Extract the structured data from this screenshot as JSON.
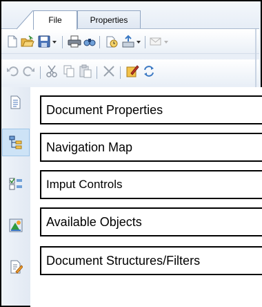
{
  "tabs": [
    {
      "label": "File",
      "active": true
    },
    {
      "label": "Properties",
      "active": false
    }
  ],
  "toolbar_row1": [
    "new-document-icon",
    "open-folder-icon",
    "save-icon",
    "dropdown-icon",
    "print-icon",
    "find-icon",
    "history-icon",
    "export-icon",
    "dropdown-icon",
    "send-mail-icon",
    "dropdown-icon"
  ],
  "toolbar_row2": [
    "undo-icon",
    "redo-icon",
    "cut-icon",
    "copy-icon",
    "paste-icon",
    "delete-icon",
    "edit-icon",
    "refresh-icon"
  ],
  "side_panels": [
    {
      "label": "Document Properties",
      "icon": "document-properties-icon"
    },
    {
      "label": "Navigation Map",
      "icon": "navigation-map-icon",
      "selected": true
    },
    {
      "label": "Imput Controls",
      "icon": "input-controls-icon"
    },
    {
      "label": "Available Objects",
      "icon": "available-objects-icon"
    },
    {
      "label": "Document Structures/Filters",
      "icon": "document-structures-icon"
    }
  ],
  "colors": {
    "border": "#000000",
    "accent": "#3a78c3",
    "selected": "#cde3f6"
  }
}
